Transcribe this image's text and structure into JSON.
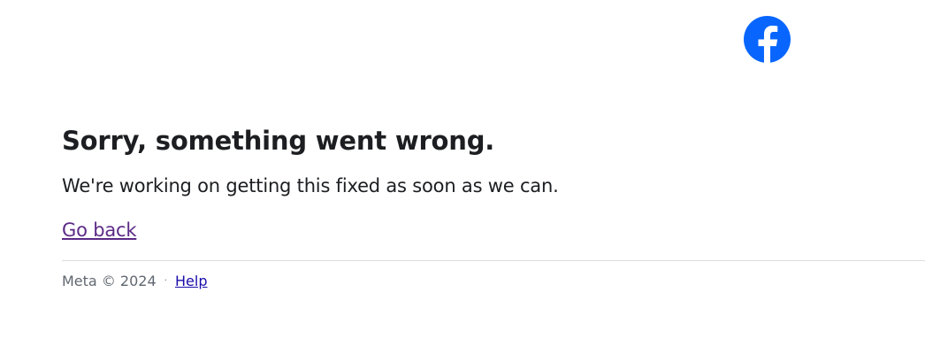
{
  "brand": {
    "logo_icon": "facebook-logo-icon",
    "color": "#0866ff"
  },
  "error": {
    "title": "Sorry, something went wrong.",
    "message": "We're working on getting this fixed as soon as we can.",
    "back_link": "Go back"
  },
  "footer": {
    "copyright": "Meta © 2024",
    "separator": "·",
    "help_link": "Help"
  },
  "colors": {
    "text": "#1c1e21",
    "link_visited": "#5b2a86",
    "link": "#1a0dab",
    "muted": "#606770",
    "divider": "#dadde1"
  }
}
